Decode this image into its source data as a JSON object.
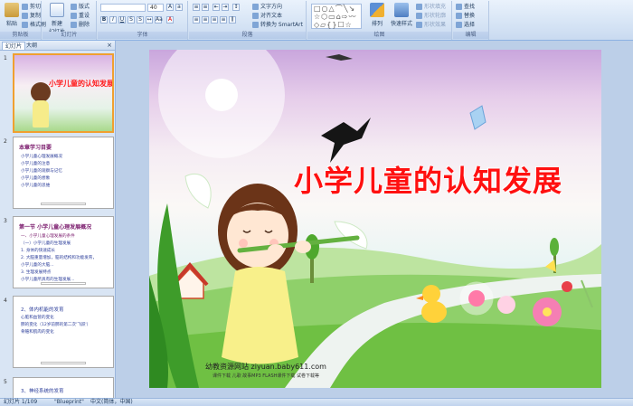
{
  "ribbon": {
    "clipboard": {
      "paste": "粘贴",
      "cut": "剪切",
      "copy": "复制",
      "format_painter": "格式刷",
      "label": "剪贴板"
    },
    "slides": {
      "new_slide": "新建\n幻灯片",
      "layout": "版式",
      "reset": "重设",
      "delete": "删除",
      "label": "幻灯片"
    },
    "font": {
      "font_size": "40",
      "label": "字体"
    },
    "paragraph": {
      "text_direction": "文字方向",
      "align_text": "对齐文本",
      "convert_smartart": "转换为 SmartArt",
      "label": "段落"
    },
    "drawing": {
      "arrange": "排列",
      "quick_styles": "快速样式",
      "shape_fill": "形状填充",
      "shape_outline": "形状轮廓",
      "shape_effects": "形状效果",
      "label": "绘图"
    },
    "editing": {
      "find": "查找",
      "replace": "替换",
      "select": "选择",
      "label": "编辑"
    }
  },
  "pane": {
    "tabs": [
      "幻灯片",
      "大纲"
    ],
    "close": "×",
    "thumbs": [
      {
        "num": "1",
        "title": "小学儿童的认知发展"
      },
      {
        "num": "2",
        "title": "本章学习目要",
        "lines": [
          "小学儿童心理发展概况",
          "小学儿童的注意",
          "小学儿童的观察与记忆",
          "小学儿童的想象",
          "小学儿童的思维"
        ]
      },
      {
        "num": "3",
        "title": "第一节 小学儿童心理发展概况",
        "lines": [
          "一、小学儿童心理发展的条件",
          "（一）小学儿童的生理发展",
          "1. 身体的快速成长",
          "2. 大脑重量增加，脑的结构和功能发育，",
          "小学儿童的大脑...",
          "3. 生理发展特点",
          "小学儿童所具有的生理发展..."
        ]
      },
      {
        "num": "4",
        "lines": [
          "2、体内机能的发育",
          "心脏和血管的变化",
          "肺的变化（12岁前肺的第二次'飞跃'）",
          "骨骼和肌肉的变化"
        ]
      },
      {
        "num": "5",
        "lines": [
          "3、神经系统的发育"
        ]
      }
    ]
  },
  "slide": {
    "title": "小学儿童的认知发展",
    "site": "幼教资源网站  ziyuan.baby611.com",
    "site_sub": "课件下载  儿歌  故事MP3  FLASH课件下载  试卷下载等"
  },
  "status": {
    "slide_info": "幻灯片 1/109",
    "theme": "\"Blueprint\"",
    "language": "中文(简体，中国)"
  }
}
